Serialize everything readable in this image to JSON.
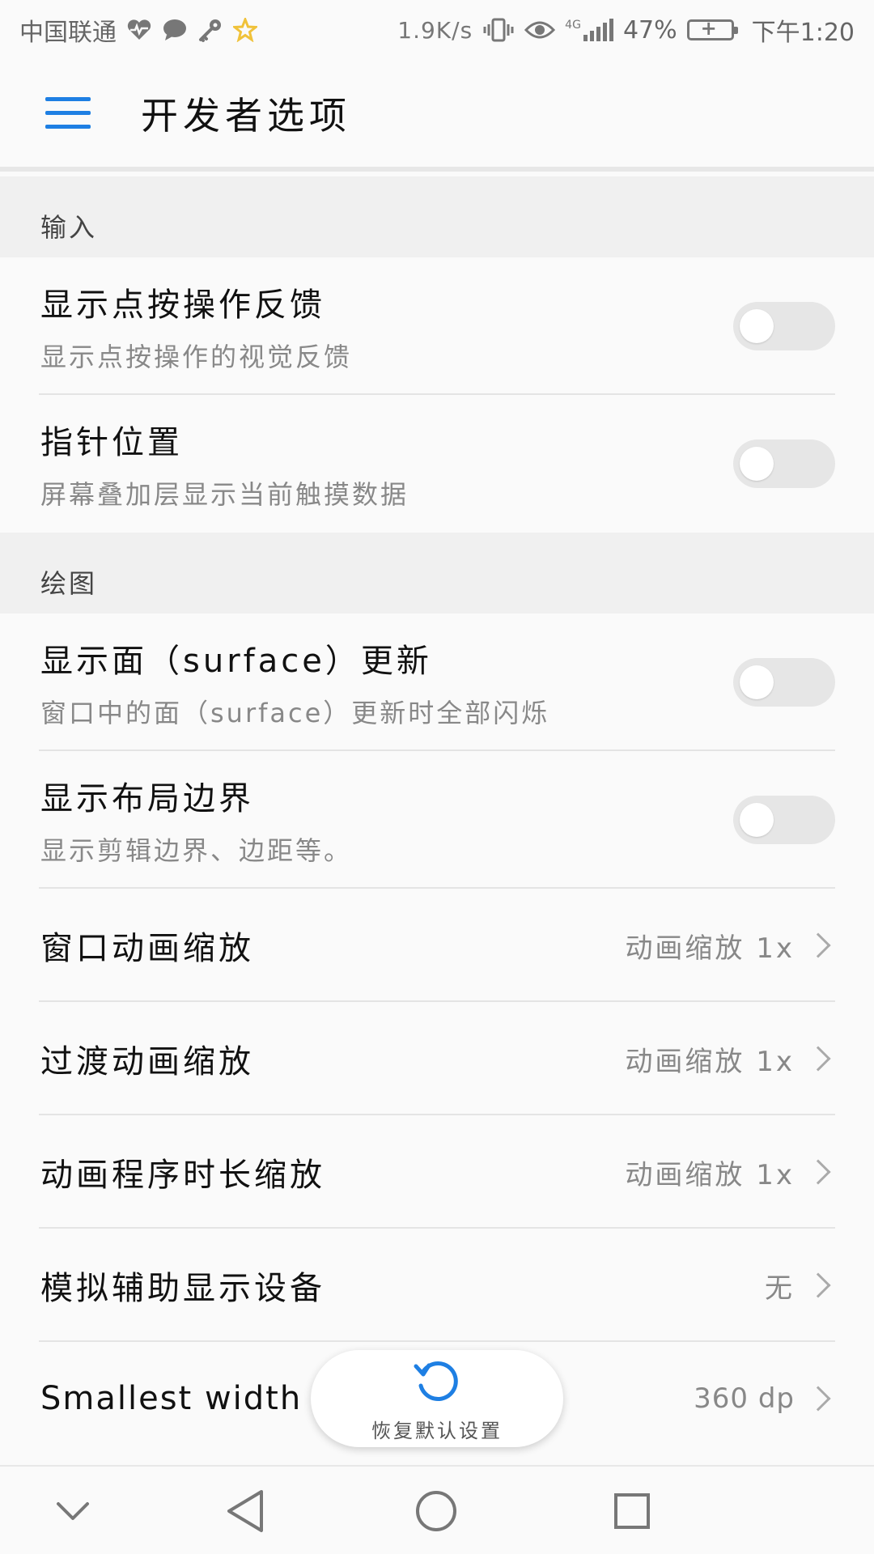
{
  "status_bar": {
    "carrier": "中国联通",
    "net_speed": "1.9K/s",
    "network_type": "4G",
    "battery": "47%",
    "time": "下午1:20",
    "icons": [
      "heart-rate-icon",
      "chat-bubble-icon",
      "key-icon",
      "star-icon",
      "vibrate-icon",
      "eye-icon",
      "signal-icon",
      "battery-charging-icon"
    ]
  },
  "app_bar": {
    "title": "开发者选项"
  },
  "sections": {
    "input": {
      "header": "输入",
      "show_taps": {
        "title": "显示点按操作反馈",
        "subtitle": "显示点按操作的视觉反馈",
        "enabled": false
      },
      "pointer_location": {
        "title": "指针位置",
        "subtitle": "屏幕叠加层显示当前触摸数据",
        "enabled": false
      }
    },
    "drawing": {
      "header": "绘图",
      "surface_updates": {
        "title": "显示面（surface）更新",
        "subtitle": "窗口中的面（surface）更新时全部闪烁",
        "enabled": false
      },
      "layout_bounds": {
        "title": "显示布局边界",
        "subtitle": "显示剪辑边界、边距等。",
        "enabled": false
      },
      "window_anim_scale": {
        "title": "窗口动画缩放",
        "value": "动画缩放 1x"
      },
      "transition_anim_scale": {
        "title": "过渡动画缩放",
        "value": "动画缩放 1x"
      },
      "animator_duration_scale": {
        "title": "动画程序时长缩放",
        "value": "动画缩放 1x"
      },
      "secondary_displays": {
        "title": "模拟辅助显示设备",
        "value": "无"
      },
      "smallest_width": {
        "title": "Smallest width",
        "value": "360 dp"
      }
    }
  },
  "reset_button": {
    "label": "恢复默认设置"
  },
  "colors": {
    "accent": "#1e7fe3",
    "toggle_off": "#e6e6e6",
    "section_bg": "#f0f0f0"
  }
}
